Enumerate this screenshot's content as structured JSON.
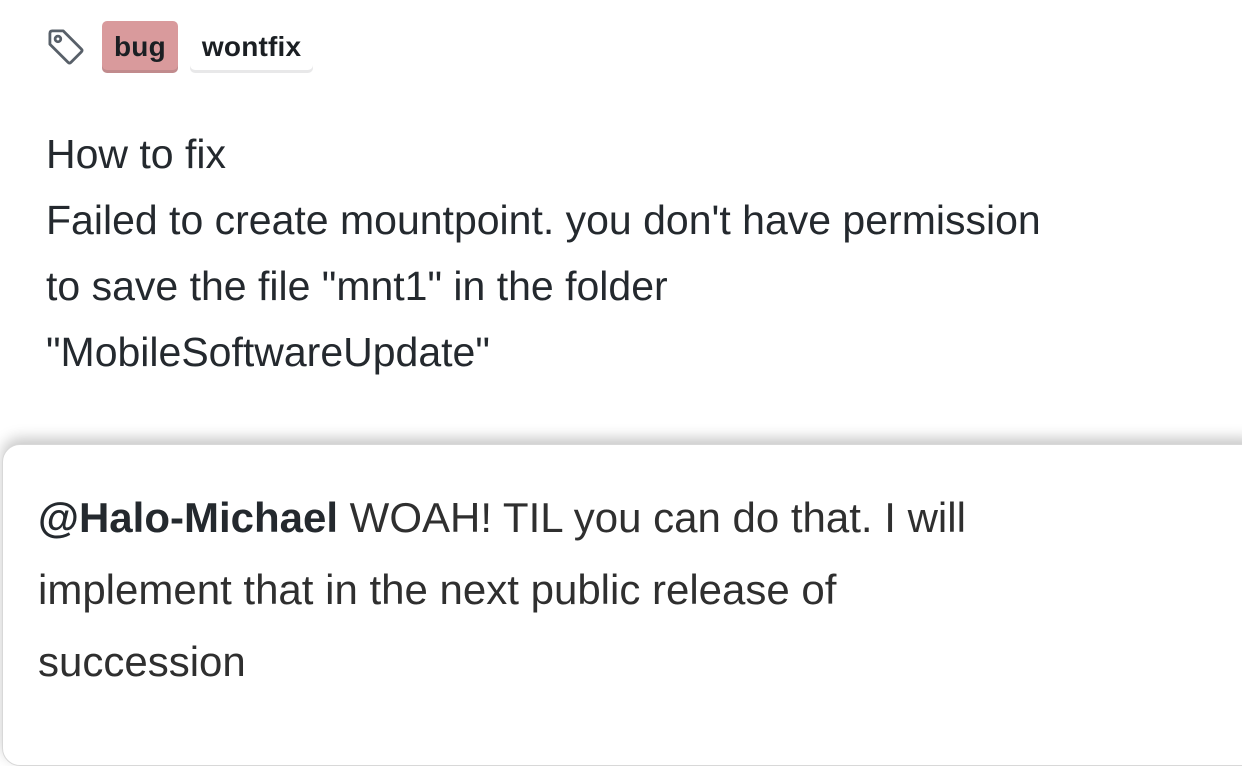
{
  "labels": {
    "icon": "tag-icon",
    "items": [
      {
        "text": "bug",
        "color": "#d99a9c"
      },
      {
        "text": "wontfix",
        "color": "#ffffff"
      }
    ]
  },
  "issue_body": {
    "lines": [
      "How to fix",
      "Failed to create mountpoint. you don't have permission",
      "to save the file \"mnt1\" in the folder",
      "\"MobileSoftwareUpdate\""
    ]
  },
  "comment": {
    "mention": "@Halo-Michael",
    "line1_rest": " WOAH! TIL you can do that. I will",
    "line2": "implement that in the next public release of",
    "line3": "succession"
  }
}
